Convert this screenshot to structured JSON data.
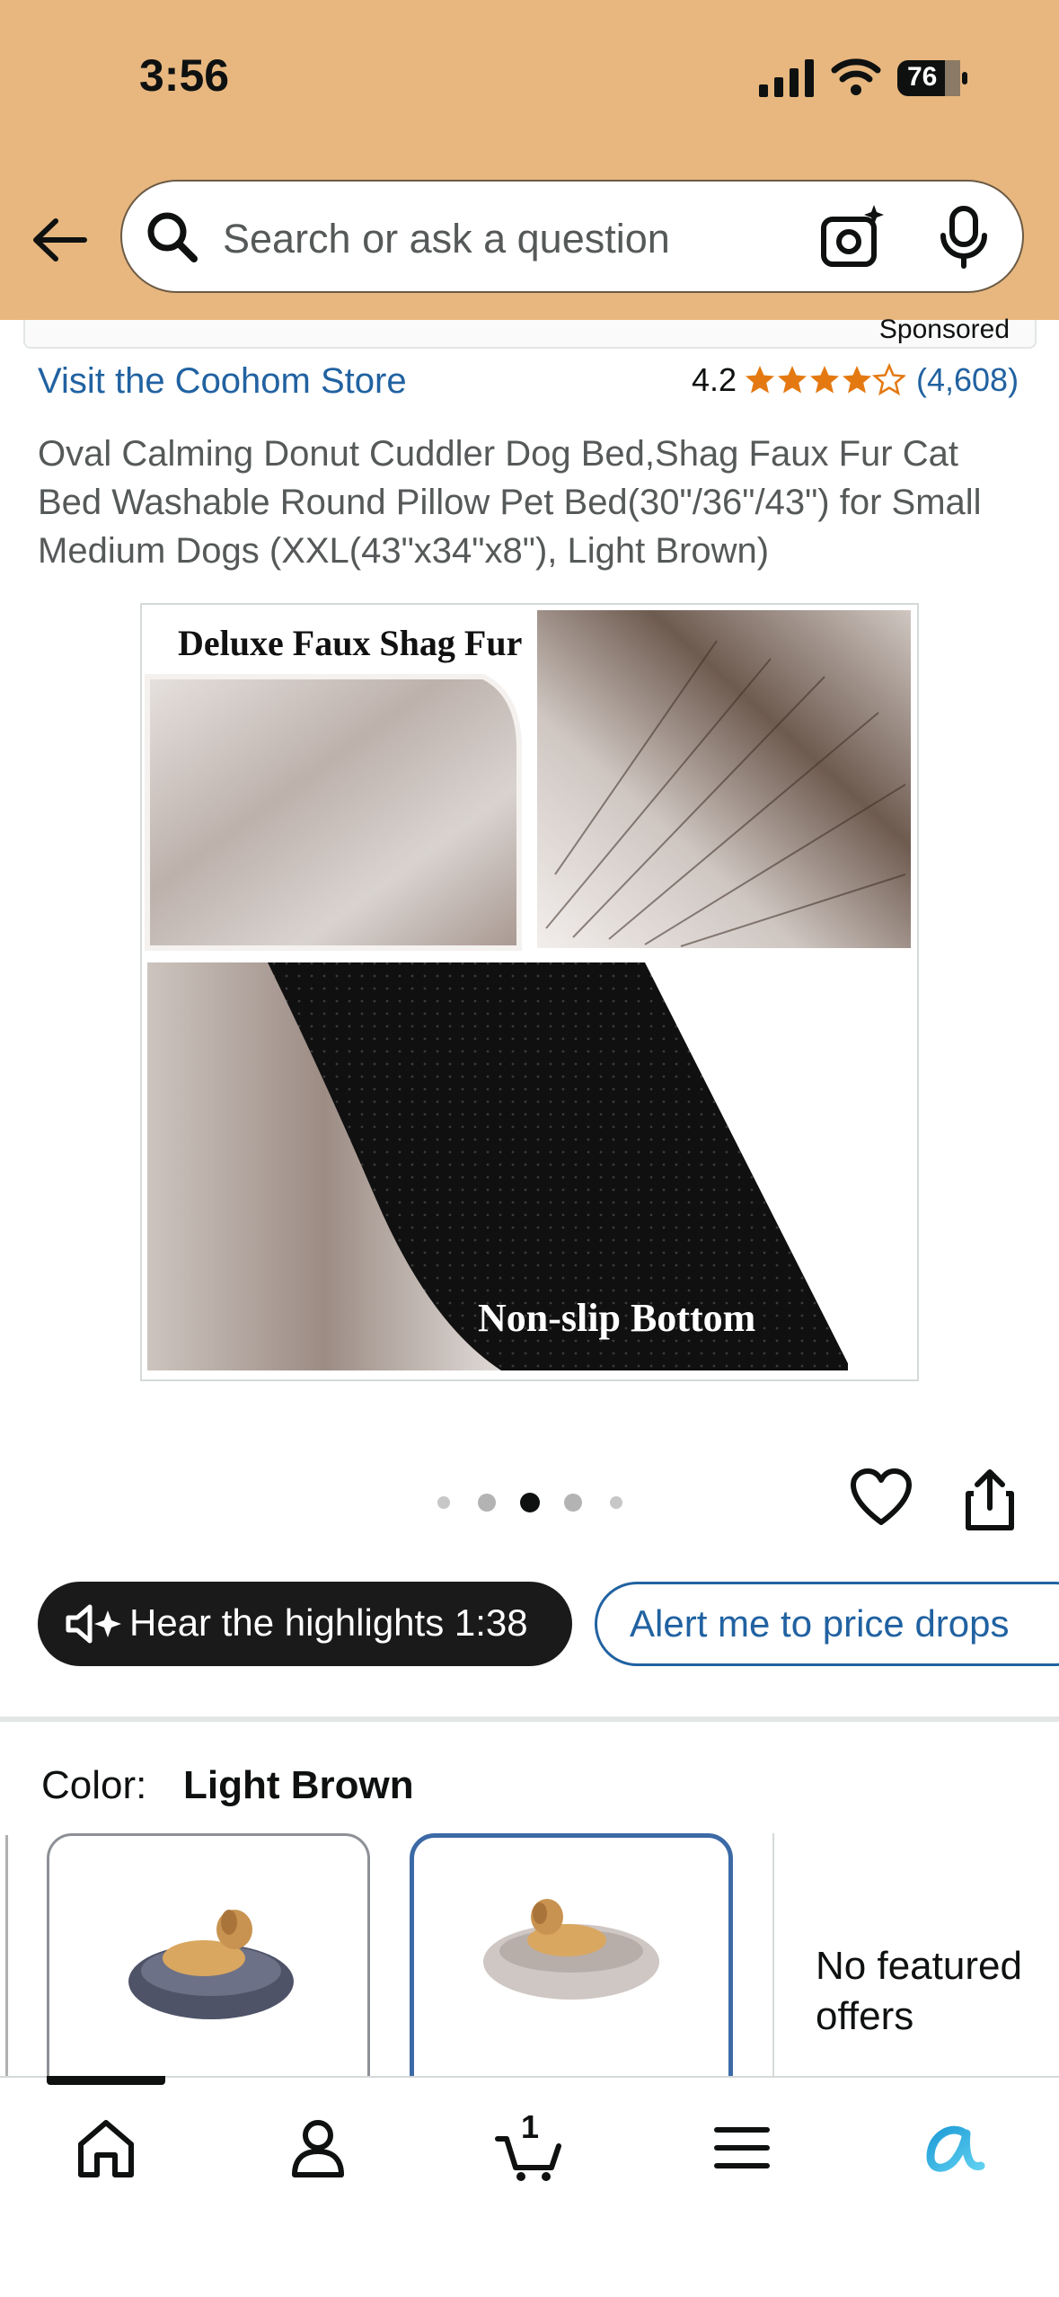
{
  "status_bar": {
    "time": "3:56",
    "battery": "76"
  },
  "search": {
    "placeholder": "Search or ask a question"
  },
  "previous_item": {
    "sponsored_label": "Sponsored"
  },
  "product": {
    "store_link": "Visit the Coohom Store",
    "rating": "4.2",
    "rating_value": 4.2,
    "review_count": "(4,608)",
    "title": "Oval Calming Donut Cuddler Dog Bed,Shag Faux Fur Cat Bed Washable Round Pillow Pet Bed(30\"/36\"/43\") for Small Medium Dogs (XXL(43\"x34\"x8\"), Light Brown)",
    "image_text": {
      "top": "Deluxe Faux Shag Fur",
      "bottom": "Non-slip Bottom"
    },
    "gallery_index": 3,
    "gallery_count": 5
  },
  "actions": {
    "hear_highlights": "Hear the highlights 1:38",
    "price_alert": "Alert me to price drops"
  },
  "variant": {
    "color_label": "Color:",
    "color_value": "Light Brown",
    "swatches": [
      {
        "name": "Dark Grey",
        "selected": false
      },
      {
        "name": "Light Brown",
        "selected": true
      }
    ],
    "no_offers": "No featured offers"
  },
  "tabbar": {
    "cart_count": "1",
    "items": [
      "home-icon",
      "account-icon",
      "cart-icon",
      "menu-icon",
      "rufus-icon"
    ]
  },
  "colors": {
    "header": "#e7b77f",
    "link": "#2162a1",
    "star": "#e47911",
    "selected_swatch": "#3c6aa6"
  }
}
